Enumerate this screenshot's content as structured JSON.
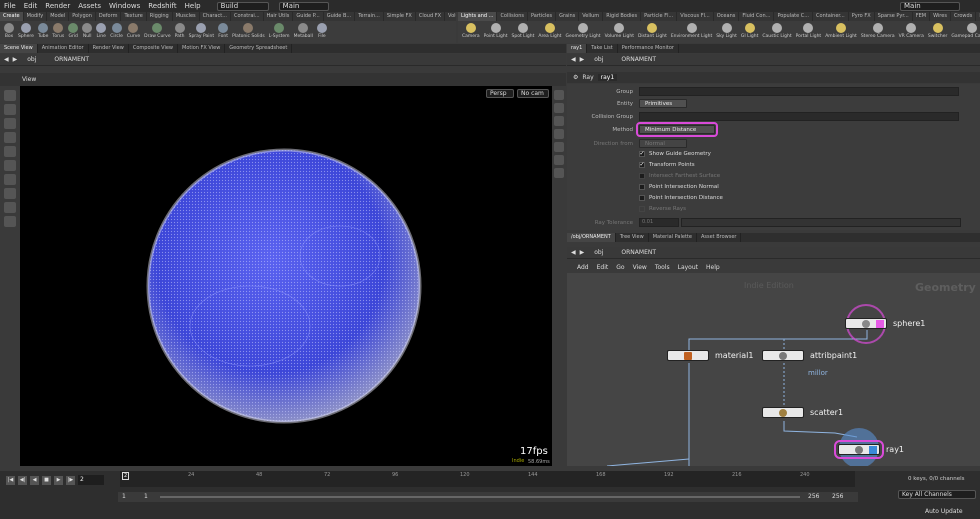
{
  "menu": [
    "File",
    "Edit",
    "Render",
    "Assets",
    "Windows",
    "Redshift",
    "Help"
  ],
  "desktop": "Build",
  "main_label": "Main",
  "main_label_right": "Main",
  "shelf_tabs_left": [
    "Create",
    "Modify",
    "Model",
    "Polygon",
    "Deform",
    "Texture",
    "Rigging",
    "Muscles",
    "Charact...",
    "Constrai...",
    "Hair Utils",
    "Guide P...",
    "Guide B...",
    "Terrain...",
    "Simple FX",
    "Cloud FX",
    "Volume"
  ],
  "shelf_tabs_right": [
    "Lights and ...",
    "Collisions",
    "Particles",
    "Grains",
    "Vellum",
    "Rigid Bodies",
    "Particle Fl...",
    "Viscous Fl...",
    "Oceans",
    "Fluid Con...",
    "Populate C...",
    "Container...",
    "Pyro FX",
    "Sparse Pyr...",
    "FEM",
    "Wires",
    "Crowds",
    "Drive Sim..."
  ],
  "tools_left": [
    "Box",
    "Sphere",
    "Tube",
    "Torus",
    "Grid",
    "Null",
    "Line",
    "Circle",
    "Curve",
    "Draw Curve",
    "Path",
    "Spray Paint",
    "Font",
    "Platonic Solids",
    "L-System",
    "Metaball",
    "File"
  ],
  "tools_right": [
    "Camera",
    "Point Light",
    "Spot Light",
    "Area Light",
    "Geometry Light",
    "Volume Light",
    "Distant Light",
    "Environment Light",
    "Sky Light",
    "GI Light",
    "Caustic Light",
    "Portal Light",
    "Ambient Light",
    "Stereo Camera",
    "VR Camera",
    "Switcher",
    "Gamepad Camera"
  ],
  "left_panel_tabs": [
    "Scene View",
    "Animation Editor",
    "Render View",
    "Composite View",
    "Motion FX View",
    "Geometry Spreadsheet"
  ],
  "path": {
    "obj": "obj",
    "node": "ORNAMENT"
  },
  "viewport": {
    "title": "View",
    "persp": "Persp",
    "cam": "No cam",
    "fps": "17fps",
    "fps_sub": "58.69ms",
    "indie": "Indie"
  },
  "right_panel_tabs": [
    "ray1",
    "Take List",
    "Performance Monitor"
  ],
  "param_header": {
    "type": "Ray",
    "name": "ray1"
  },
  "params": {
    "group_label": "Group",
    "entity_label": "Entity",
    "entity_value": "Primitives",
    "collision_label": "Collision Group",
    "method_label": "Method",
    "method_value": "Minimum Distance",
    "direction_label": "Direction from",
    "direction_value": "Normal",
    "show_guide": "Show Guide Geometry",
    "transform_points": "Transform Points",
    "intersect_farthest": "Intersect Farthest Surface",
    "point_normal": "Point Intersection Normal",
    "point_distance": "Point Intersection Distance",
    "reverse_rays": "Reverse Rays",
    "ray_tolerance_label": "Ray Tolerance",
    "ray_tolerance_value": "0.01"
  },
  "network_tabs": [
    "/obj/ORNAMENT",
    "Tree View",
    "Material Palette",
    "Asset Browser"
  ],
  "network_menu": [
    "Add",
    "Edit",
    "Go",
    "View",
    "Tools",
    "Layout",
    "Help"
  ],
  "network": {
    "watermark": "Indie Edition",
    "context": "Geometry"
  },
  "nodes": {
    "sphere": "sphere1",
    "material": "material1",
    "attribpaint": "attribpaint1",
    "attrib_sub": "millor",
    "scatter": "scatter1",
    "ray": "ray1"
  },
  "timeline": {
    "ticks": [
      "2",
      "24",
      "48",
      "72",
      "96",
      "120",
      "144",
      "168",
      "192",
      "216",
      "240"
    ],
    "frame": "2",
    "start": "1",
    "start2": "1",
    "end": "256",
    "end2": "256",
    "keys": "0 keys, 0/0 channels",
    "key_all": "Key All Channels",
    "auto_update": "Auto Update"
  },
  "colors": {
    "accent": "#d94bd9",
    "sphere_blue": "#4a55e0",
    "viewport_bg": "#000000",
    "net_bg": "#454545"
  }
}
